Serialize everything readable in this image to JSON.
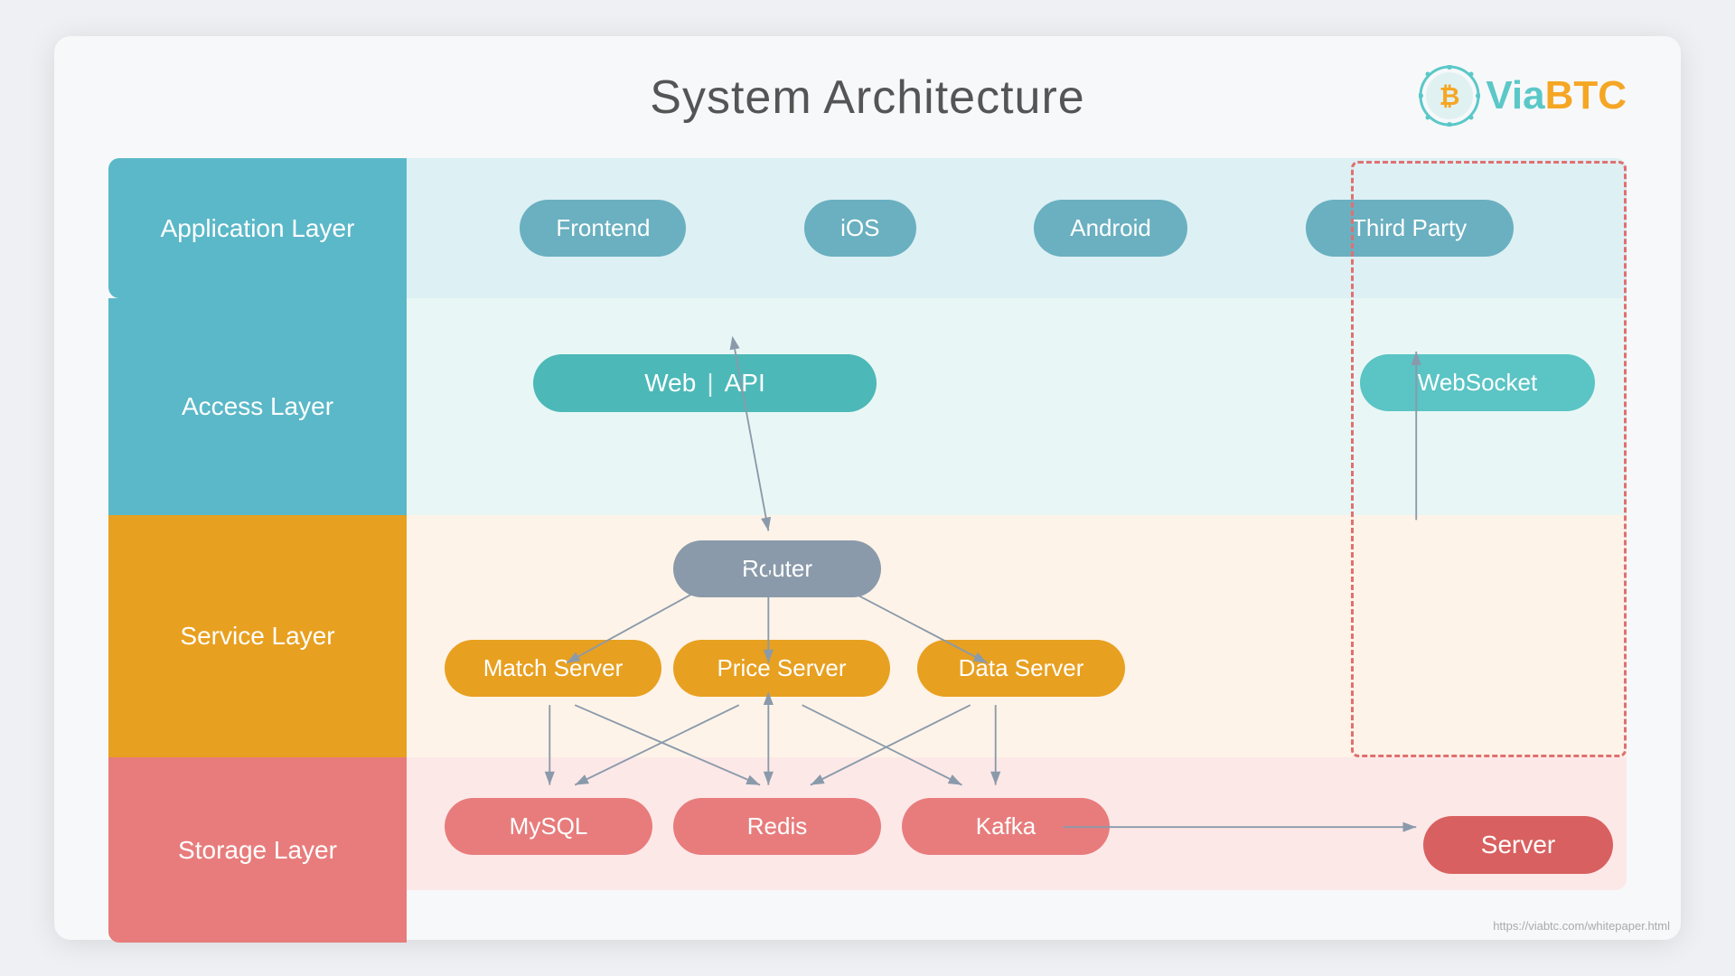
{
  "title": "System Architecture",
  "logo": {
    "via": "Via",
    "btc": "BTC"
  },
  "layers": {
    "application": "Application Layer",
    "access": "Access Layer",
    "service": "Service Layer",
    "storage": "Storage Layer"
  },
  "app_pills": {
    "frontend": "Frontend",
    "ios": "iOS",
    "android": "Android",
    "third_party": "Third Party"
  },
  "access_pills": {
    "web": "Web",
    "divider": "|",
    "api": "API",
    "websocket": "WebSocket"
  },
  "service_pills": {
    "router": "Router",
    "match_server": "Match Server",
    "price_server": "Price Server",
    "data_server": "Data Server"
  },
  "storage_pills": {
    "mysql": "MySQL",
    "redis": "Redis",
    "kafka": "Kafka"
  },
  "server": "Server",
  "watermark": "https://viabtc.com/whitepaper.html",
  "colors": {
    "teal": "#5bb8c8",
    "orange": "#e8a020",
    "red": "#e87c7c",
    "dashed_border": "#e87c7c"
  }
}
